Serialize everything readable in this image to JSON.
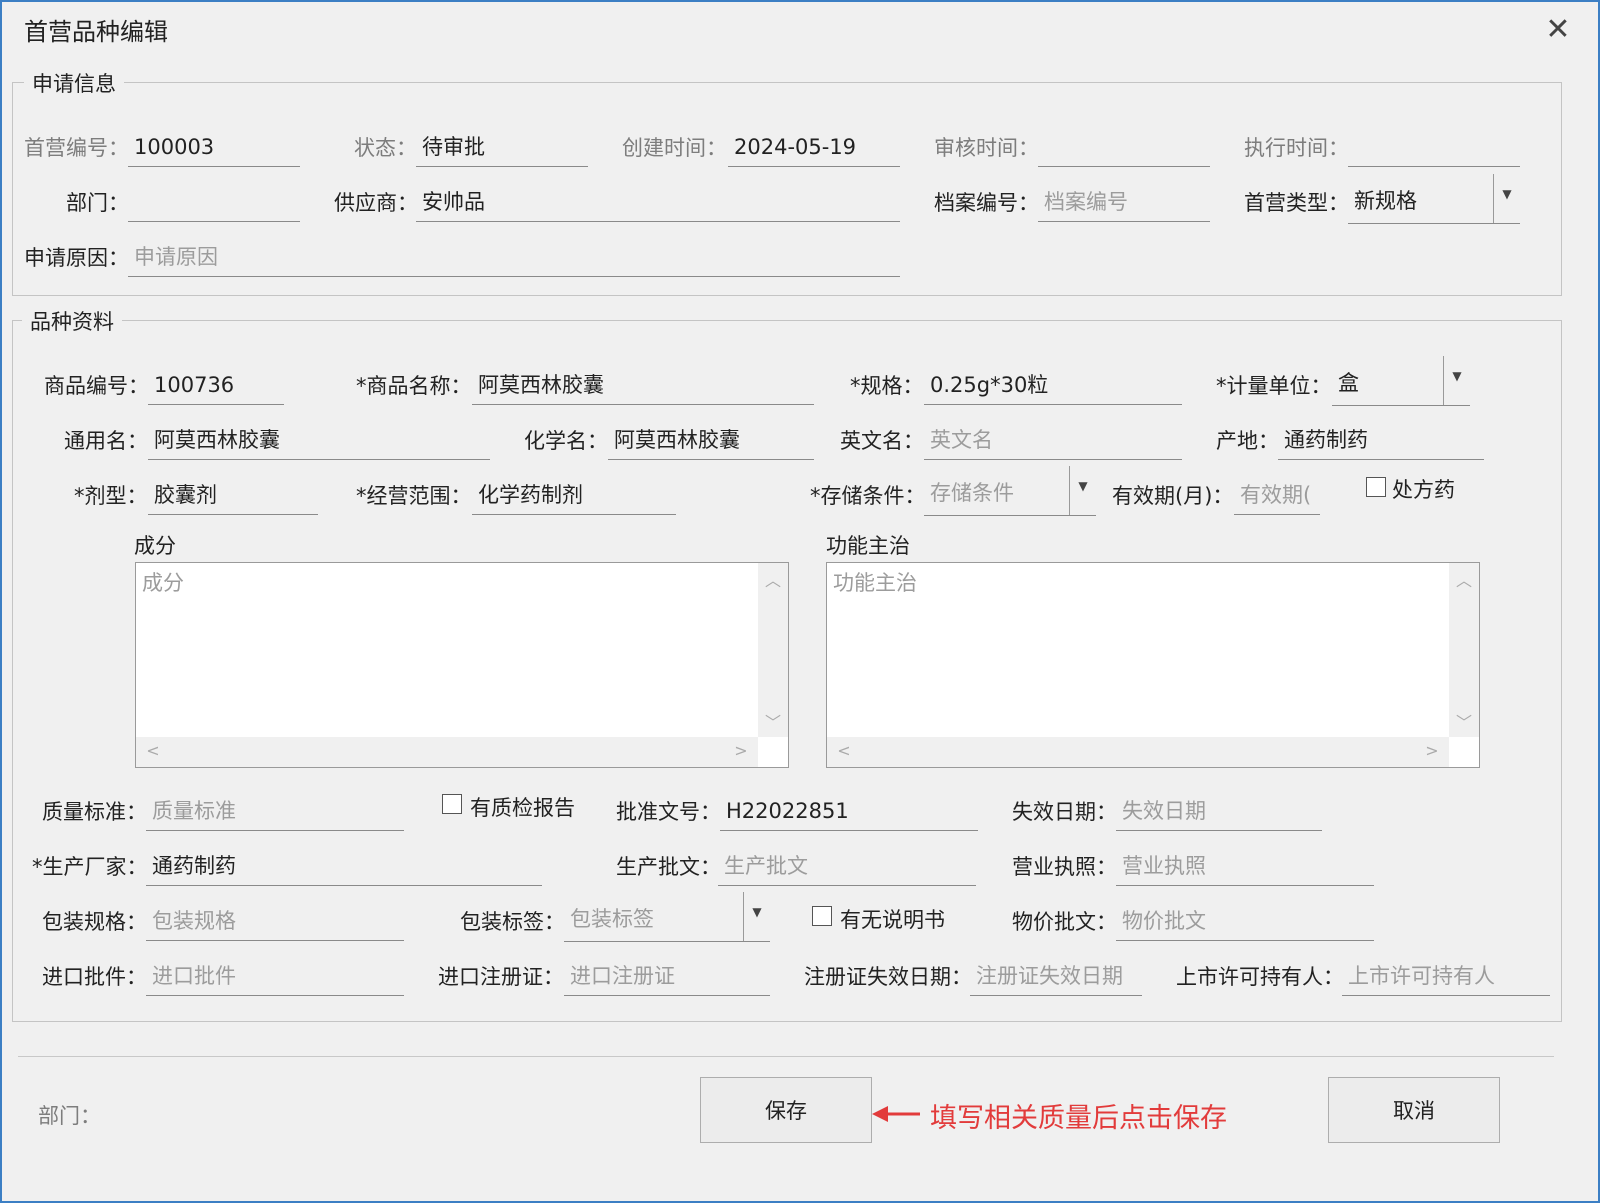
{
  "window": {
    "title": "首营品种编辑"
  },
  "colors": {
    "accent_border": "#3c7fc4",
    "annotation": "#e23b3b"
  },
  "application_info": {
    "legend": "申请信息",
    "first_no_label": "首营编号：",
    "first_no_value": "100003",
    "status_label": "状态：",
    "status_value": "待审批",
    "created_label": "创建时间：",
    "created_value": "2024-05-19",
    "review_label": "审核时间：",
    "review_value": "",
    "exec_label": "执行时间：",
    "exec_value": "",
    "dept_label": "部门：",
    "dept_value": "",
    "supplier_label": "供应商：",
    "supplier_value": "安帅品",
    "archive_label": "档案编号：",
    "archive_placeholder": "档案编号",
    "type_label": "首营类型：",
    "type_value": "新规格",
    "reason_label": "申请原因：",
    "reason_placeholder": "申请原因"
  },
  "variety_info": {
    "legend": "品种资料",
    "product_no_label": "商品编号：",
    "product_no_value": "100736",
    "product_name_label": "*商品名称：",
    "product_name_value": "阿莫西林胶囊",
    "spec_label": "*规格：",
    "spec_value": "0.25g*30粒",
    "unit_label": "*计量单位：",
    "unit_value": "盒",
    "generic_label": "通用名：",
    "generic_value": "阿莫西林胶囊",
    "chemical_label": "化学名：",
    "chemical_value": "阿莫西林胶囊",
    "english_label": "英文名：",
    "english_placeholder": "英文名",
    "origin_label": "产地：",
    "origin_value": "通药制药",
    "dosage_label": "*剂型：",
    "dosage_value": "胶囊剂",
    "scope_label": "*经营范围：",
    "scope_value": "化学药制剂",
    "storage_label": "*存储条件：",
    "storage_placeholder": "存储条件",
    "validity_label": "有效期(月)：",
    "validity_placeholder": "有效期( ",
    "rx_label": "处方药",
    "ingredients_label": "成分",
    "ingredients_placeholder": "成分",
    "indications_label": "功能主治",
    "indications_placeholder": "功能主治",
    "quality_std_label": "质量标准：",
    "quality_std_placeholder": "质量标准",
    "qc_report_label": "有质检报告",
    "approval_no_label": "批准文号：",
    "approval_no_value": "H22022851",
    "expiry_label": "失效日期：",
    "expiry_placeholder": "失效日期",
    "manufacturer_label": "*生产厂家：",
    "manufacturer_value": "通药制药",
    "prod_approval_label": "生产批文：",
    "prod_approval_placeholder": "生产批文",
    "license_label": "营业执照：",
    "license_placeholder": "营业执照",
    "pack_spec_label": "包装规格：",
    "pack_spec_placeholder": "包装规格",
    "pack_label_label": "包装标签：",
    "pack_label_placeholder": "包装标签",
    "manual_label": "有无说明书",
    "price_approval_label": "物价批文：",
    "price_approval_placeholder": "物价批文",
    "import_approval_label": "进口批件：",
    "import_approval_placeholder": "进口批件",
    "import_reg_label": "进口注册证：",
    "import_reg_placeholder": "进口注册证",
    "reg_expiry_label": "注册证失效日期：",
    "reg_expiry_placeholder": "注册证失效日期",
    "mah_label": "上市许可持有人：",
    "mah_placeholder": "上市许可持有人"
  },
  "footer": {
    "dept_label": "部门：",
    "save_label": "保存",
    "cancel_label": "取消",
    "annotation": "填写相关质量后点击保存"
  }
}
